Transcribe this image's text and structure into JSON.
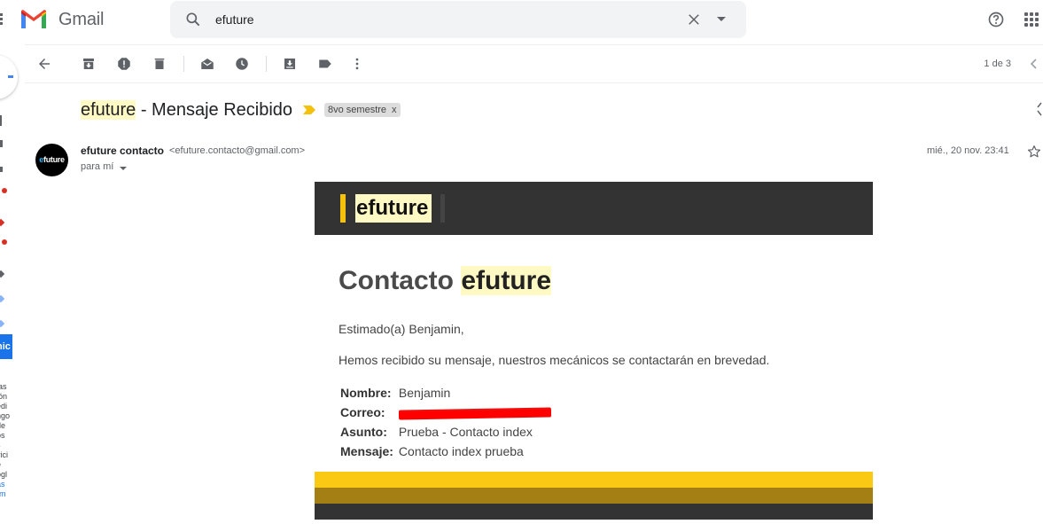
{
  "app": {
    "name": "Gmail"
  },
  "search": {
    "value": "efuture"
  },
  "toolbar": {
    "pager": "1 de 3"
  },
  "sidebar": {
    "hangouts_label": "nic",
    "text_fragments": [
      "i",
      "ias",
      "ión",
      "edi",
      "",
      "ngo",
      "de",
      "os",
      "s",
      "vici",
      "e",
      "ogl",
      "as",
      "rm"
    ]
  },
  "email": {
    "subject_highlight": "efuture",
    "subject_rest": " - Mensaje Recibido",
    "label": "8vo semestre",
    "label_remove": "x",
    "sender_name": "efuture contacto",
    "sender_email": "<efuture.contacto@gmail.com>",
    "recipient": "para mí",
    "date": "mié., 20 nov. 23:41",
    "avatar_text_e": "e",
    "avatar_text_rest": "future",
    "body": {
      "brand": "efuture",
      "title_prefix": "Contacto ",
      "title_highlight": "efuture",
      "greeting": "Estimado(a) Benjamin,",
      "message": "Hemos recibido su mensaje, nuestros mecánicos se contactarán en brevedad.",
      "fields": {
        "nombre_label": "Nombre:",
        "nombre_value": "Benjamin",
        "correo_label": "Correo:",
        "asunto_label": "Asunto:",
        "asunto_value": "Prueba - Contacto index",
        "mensaje_label": "Mensaje:",
        "mensaje_value": "Contacto index prueba"
      }
    }
  },
  "colors": {
    "brand_yellow": "#f9c913",
    "brand_dark": "#333333",
    "highlight": "#fff9c4",
    "gmail_red": "#ea4335"
  },
  "icons": {
    "top": [
      "menu-icon",
      "gmail-logo",
      "search-icon",
      "clear-icon",
      "search-options-icon",
      "help-icon",
      "apps-icon"
    ],
    "toolbar": [
      "back-icon",
      "archive-icon",
      "report-spam-icon",
      "delete-icon",
      "mark-unread-icon",
      "snooze-icon",
      "move-to-icon",
      "label-icon",
      "more-icon",
      "prev-icon"
    ]
  }
}
